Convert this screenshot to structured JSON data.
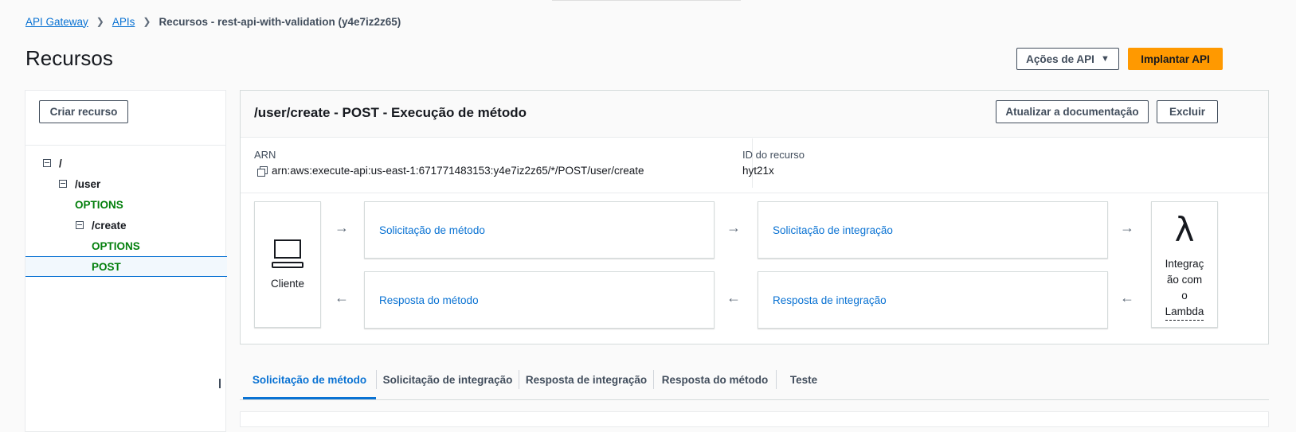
{
  "breadcrumb": {
    "items": [
      "API Gateway",
      "APIs"
    ],
    "current": "Recursos - rest-api-with-validation (y4e7iz2z65)"
  },
  "page": {
    "title": "Recursos",
    "actions_label": "Ações de API",
    "deploy_label": "Implantar API"
  },
  "sidebar": {
    "create_resource_label": "Criar recurso",
    "tree": [
      {
        "label": "/",
        "type": "path"
      },
      {
        "label": "/user",
        "type": "path"
      },
      {
        "label": "OPTIONS",
        "type": "method"
      },
      {
        "label": "/create",
        "type": "path"
      },
      {
        "label": "OPTIONS",
        "type": "method"
      },
      {
        "label": "POST",
        "type": "method",
        "selected": true
      }
    ]
  },
  "method_panel": {
    "title": "/user/create - POST - Execução de método",
    "update_docs_label": "Atualizar a documentação",
    "delete_label": "Excluir",
    "arn_label": "ARN",
    "arn_value": "arn:aws:execute-api:us-east-1:671771483153:y4e7iz2z65/*/POST/user/create",
    "resource_id_label": "ID do recurso",
    "resource_id_value": "hyt21x"
  },
  "flow": {
    "client_label": "Cliente",
    "method_request": "Solicitação de método",
    "integration_request": "Solicitação de integração",
    "method_response": "Resposta do método",
    "integration_response": "Resposta de integração",
    "lambda_line1": "Integraç",
    "lambda_line2": "ão com",
    "lambda_line3": "o",
    "lambda_line4": "Lambda",
    "lambda_icon": "λ",
    "arrow_right": "→",
    "arrow_left": "←"
  },
  "tabs": [
    {
      "label": "Solicitação de método",
      "active": true
    },
    {
      "label": "Solicitação de integração"
    },
    {
      "label": "Resposta de integração"
    },
    {
      "label": "Resposta do método"
    },
    {
      "label": "Teste"
    }
  ],
  "colors": {
    "link": "#0972d3",
    "method": "#037f0c",
    "primary_button": "#ff9900"
  },
  "icons": {
    "collapse": "minus-square-icon",
    "copy": "copy-icon",
    "client": "laptop-icon",
    "integration": "lambda-icon"
  }
}
